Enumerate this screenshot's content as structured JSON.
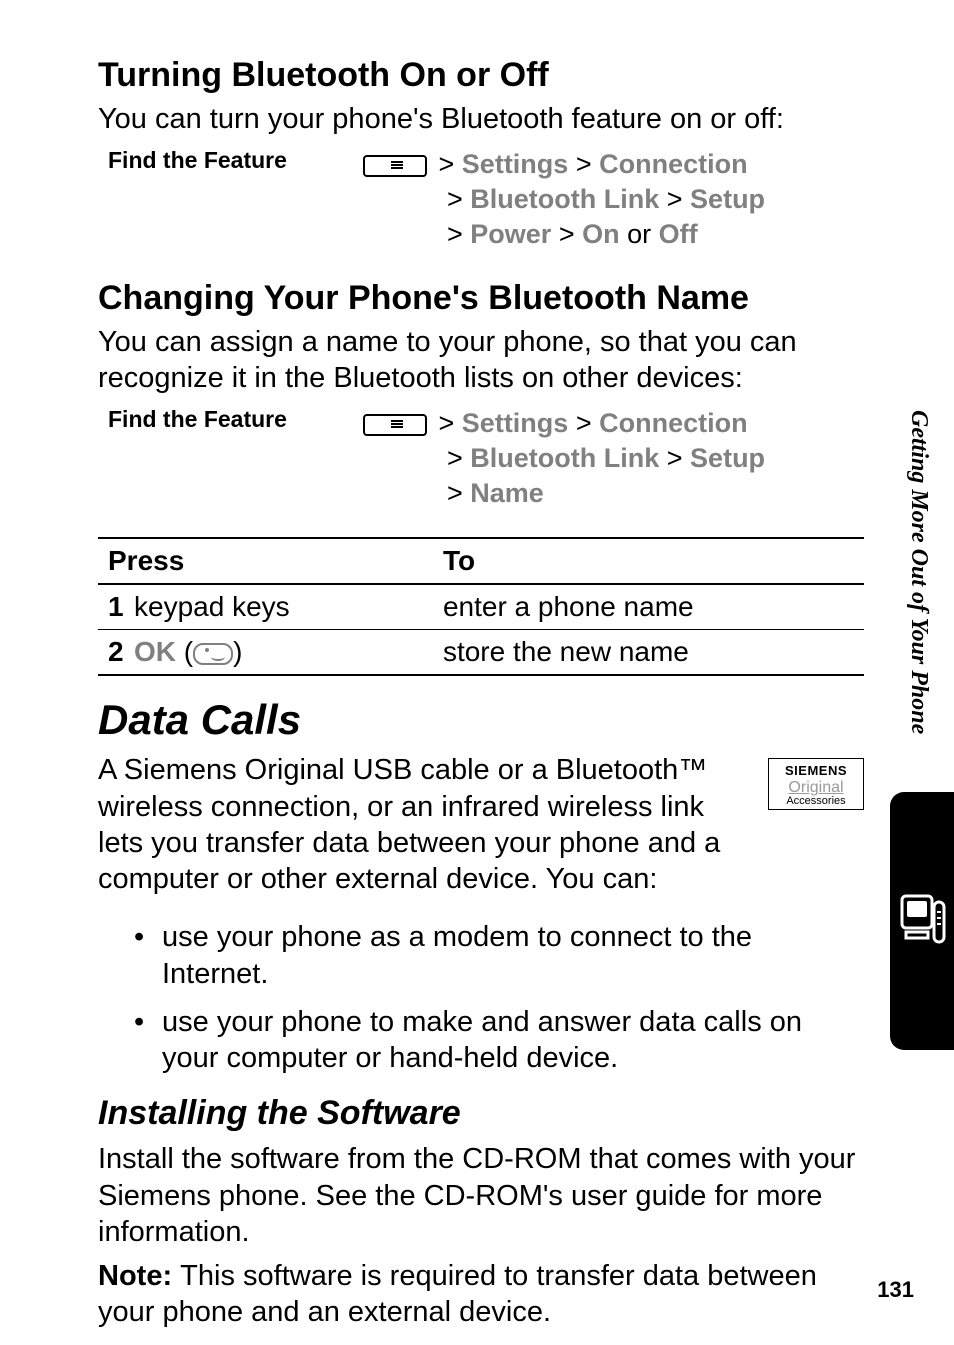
{
  "side_label": "Getting More Out of Your Phone",
  "page_number": "131",
  "s1": {
    "heading": "Turning Bluetooth On or Off",
    "intro": "You can turn your phone's Bluetooth feature on or off:",
    "ftf": "Find the Feature",
    "nav": {
      "l1a": "Settings",
      "l1b": "Connection",
      "l2a": "Bluetooth Link",
      "l2b": "Setup",
      "l3a": "Power",
      "l3b": "On",
      "l3or": " or ",
      "l3c": "Off"
    }
  },
  "s2": {
    "heading": "Changing Your Phone's Bluetooth Name",
    "intro": "You can assign a name to your phone, so that you can recognize it in the Bluetooth lists on other devices:",
    "ftf": "Find the Feature",
    "nav": {
      "l1a": "Settings",
      "l1b": "Connection",
      "l2a": "Bluetooth Link",
      "l2b": "Setup",
      "l3a": "Name"
    }
  },
  "table": {
    "h_press": "Press",
    "h_to": "To",
    "rows": [
      {
        "n": "1",
        "press": "keypad keys",
        "to": "enter a phone name",
        "ok": false
      },
      {
        "n": "2",
        "press": "OK",
        "to": "store the new name",
        "ok": true
      }
    ]
  },
  "s3": {
    "heading": "Data Calls",
    "intro": "A Siemens Original USB cable or a Bluetooth™ wireless connection, or an infrared wireless link lets you transfer data between your phone and a computer or other external device. You can:",
    "box": {
      "brand": "SIEMENS",
      "orig": "Original",
      "acc": "Accessories"
    },
    "bullets": [
      "use your phone as a modem to connect to the Internet.",
      "use your phone to make and answer data calls on your computer or hand-held device."
    ]
  },
  "s4": {
    "heading": "Installing the Software",
    "p1": "Install the software from the CD-ROM that comes with your Siemens phone. See the CD-ROM's user guide for more information.",
    "note_label": "Note: ",
    "note_body": "This software is required to transfer data between your phone and an external device."
  }
}
